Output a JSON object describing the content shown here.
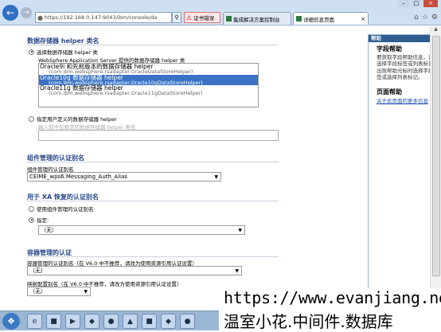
{
  "browser": {
    "url": "https://192.168.0.147:9043/ibm/console/da",
    "cert_error": "证书错误",
    "tabs": [
      {
        "label": "集成解决方案控制台"
      },
      {
        "label": "详细信息页面"
      }
    ],
    "icons": {
      "back": "back-arrow-icon",
      "forward": "forward-arrow-icon",
      "home": "home-icon",
      "star": "favorites-icon",
      "gear": "gear-icon"
    }
  },
  "section_helper": {
    "title": "数据存储器 helper 类名",
    "radio_select_label": "选择数据存储器 helper 类",
    "provided_label": "WebSphere Application Server 提供的数据存储器 helper 类",
    "options": [
      {
        "name": "Oracle9i 和先前版本的数据存储器 helper",
        "cls": "(com.ibm.websphere.rsadapter.OracleDataStoreHelper)",
        "selected": false
      },
      {
        "name": "Oracle10g 数据存储器 helper",
        "cls": "(com.ibm.websphere.rsadapter.Oracle10gDataStoreHelper)",
        "selected": true
      },
      {
        "name": "Oracle11g 数据存储器 helper",
        "cls": "(com.ibm.websphere.rsadapter.Oracle11gDataStoreHelper)",
        "selected": false
      }
    ],
    "radio_custom_label": "指定用户定义的数据存储器 helper",
    "custom_input_label": "输入软件包限定的数据存储器 helper 类名"
  },
  "section_component_auth": {
    "title": "组件管理的认证别名",
    "field_label": "组件管理的认证别名",
    "value": "CEIME_wps6.Messaging_Auth_Alias"
  },
  "section_xa": {
    "title": "用于 XA 恢复的认证别名",
    "radio_use_component": "使用组件管理的认证别名",
    "radio_specify": "指定:",
    "value": "（无）"
  },
  "section_container_auth": {
    "title": "容器管理的认证",
    "container_label": "容器管理的认证别名（在 V6.0 中不推荐，请改为使用资源引用认证设置）",
    "container_value": "（无）",
    "mapping_label": "映射配置别名（在 V6.0 中不推荐，请改为使用资源引用认证设置）",
    "mapping_value": "（无）"
  },
  "help": {
    "header": "帮助",
    "field_help_title": "字段帮助",
    "field_help_lines": [
      "要获取字段帮助信息，请",
      "选择字段标签或列表标记",
      "出现帮助光标时选择字段",
      "签或选择列表标记。"
    ],
    "page_help_title": "页面帮助",
    "page_help_link": "关于此页面的更多信息"
  },
  "watermark": {
    "url": "https://www.evanjiang.net",
    "text": "温室小花.中间件.数据库"
  }
}
